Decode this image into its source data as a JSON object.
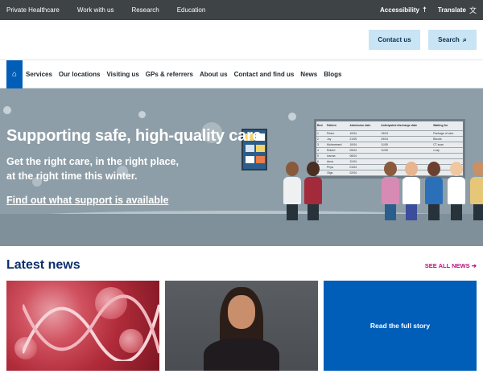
{
  "topbar": {
    "links": [
      "Private Healthcare",
      "Work with us",
      "Research",
      "Education"
    ],
    "accessibility": "Accessibility",
    "translate": "Translate"
  },
  "header": {
    "contact_label": "Contact us",
    "search_label": "Search"
  },
  "nav": {
    "items": [
      "Services",
      "Our locations",
      "Visiting us",
      "GPs & referrers",
      "About us",
      "Contact and find us",
      "News",
      "Blogs"
    ]
  },
  "hero": {
    "title": "Supporting safe, high-quality care",
    "subtitle_line1": "Get the right care, in the right place,",
    "subtitle_line2": "at the right time this winter.",
    "link": "Find out what support is available",
    "board": {
      "headers": [
        "Bed",
        "Patient",
        "Admission date",
        "Anticipated discharge date",
        "Waiting for"
      ],
      "rows": [
        [
          "1",
          "Pedro",
          "10/04",
          "19/04",
          "Package of care"
        ],
        [
          "2",
          "Joy",
          "21/05",
          "29/04",
          "Bloods"
        ],
        [
          "3",
          "Mohammed",
          "10/04",
          "11/05",
          "CT scan"
        ],
        [
          "4",
          "Robert",
          "09/04",
          "11/05",
          "x-ray"
        ],
        [
          "5",
          "Ivanna",
          "06/04",
          "",
          ""
        ],
        [
          "6",
          "Anna",
          "11/04",
          "",
          ""
        ],
        [
          "7",
          "Priya",
          "01/04",
          "",
          ""
        ],
        [
          "8",
          "Olga",
          "02/04",
          "",
          ""
        ]
      ]
    }
  },
  "news": {
    "heading": "Latest news",
    "see_all": "SEE ALL NEWS",
    "card3_label": "Read the full story"
  },
  "colors": {
    "topbar": "#3e4346",
    "primary_blue": "#005eb8",
    "light_blue_button": "#c9e4f5",
    "hero_bg": "#8e9ea8",
    "heading_navy": "#0b2f6a",
    "see_all_pink": "#b8127e"
  }
}
